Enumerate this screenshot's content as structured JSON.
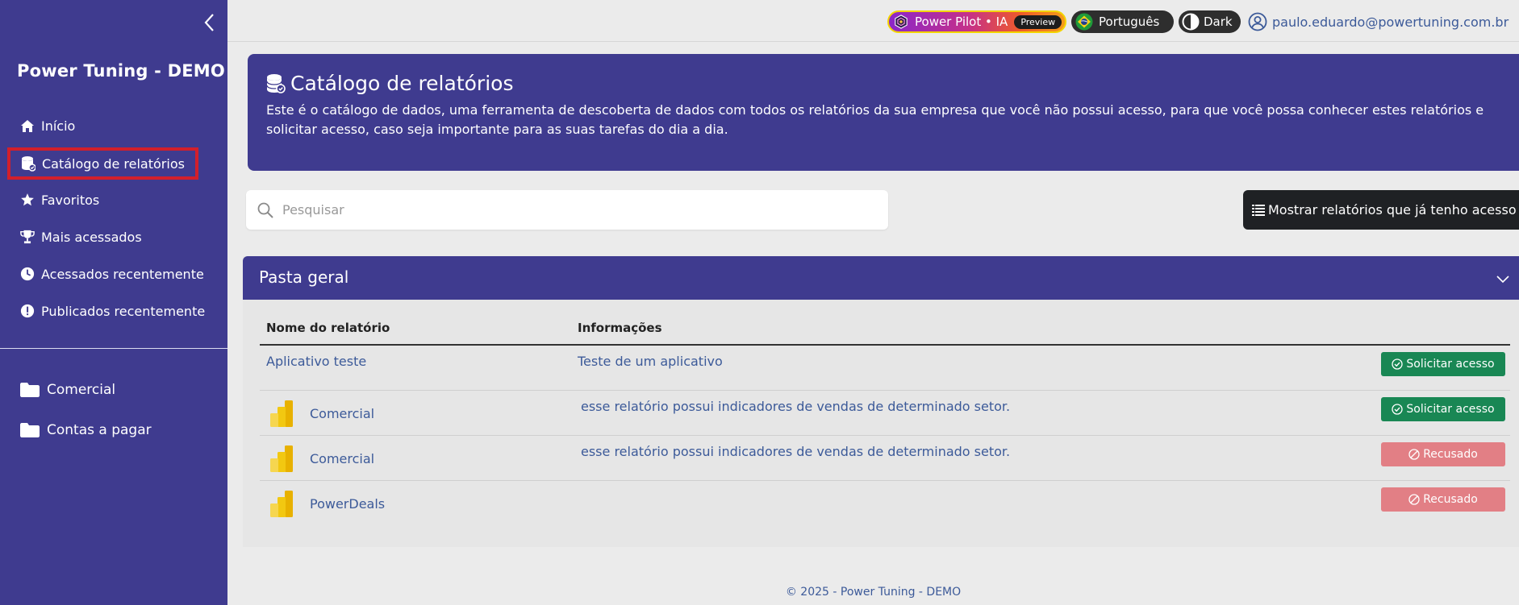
{
  "sidebar": {
    "brand": "Power Tuning - DEMO",
    "nav": [
      {
        "label": "Início",
        "icon": "home-icon"
      },
      {
        "label": "Catálogo de relatórios",
        "icon": "database-icon"
      },
      {
        "label": "Favoritos",
        "icon": "star-icon"
      },
      {
        "label": "Mais acessados",
        "icon": "trophy-icon"
      },
      {
        "label": "Acessados recentemente",
        "icon": "clock-icon"
      },
      {
        "label": "Publicados recentemente",
        "icon": "exclamation-circle-icon"
      }
    ],
    "folders": [
      {
        "label": "Comercial",
        "icon": "folder-icon"
      },
      {
        "label": "Contas a pagar",
        "icon": "folder-icon"
      }
    ]
  },
  "topbar": {
    "pilot_label": "Power Pilot • IA",
    "preview_badge": "Preview",
    "language": "Português",
    "theme": "Dark",
    "user_email": "paulo.eduardo@powertuning.com.br"
  },
  "hero": {
    "title": "Catálogo de relatórios",
    "description": "Este é o catálogo de dados, uma ferramenta de descoberta de dados com todos os relatórios da sua empresa que você não possui acesso, para que você possa conhecer estes relatórios e solicitar acesso, caso seja importante para as suas tarefas do dia a dia."
  },
  "search": {
    "placeholder": "Pesquisar"
  },
  "show_access_button": "Mostrar relatórios que já tenho acesso",
  "folder_panel": {
    "title": "Pasta geral",
    "columns": {
      "name": "Nome do relatório",
      "info": "Informações"
    },
    "rows": [
      {
        "name": "Aplicativo teste",
        "info": "Teste de um aplicativo",
        "action": "Solicitar acesso",
        "status": "request",
        "has_pbi_icon": false
      },
      {
        "name": "Comercial",
        "info": "esse relatório possui indicadores de vendas de determinado setor.",
        "action": "Solicitar acesso",
        "status": "request",
        "has_pbi_icon": true
      },
      {
        "name": "Comercial",
        "info": "esse relatório possui indicadores de vendas de determinado setor.",
        "action": "Recusado",
        "status": "refused",
        "has_pbi_icon": true
      },
      {
        "name": "PowerDeals",
        "info": "",
        "action": "Recusado",
        "status": "refused",
        "has_pbi_icon": true
      }
    ]
  },
  "footer": "© 2025 - Power Tuning - DEMO",
  "colors": {
    "primary": "#3f3b8f",
    "active_outline": "#d21f2b",
    "request_green": "#198754",
    "refused_red": "#e27f85",
    "link_blue": "#3c5a99"
  }
}
